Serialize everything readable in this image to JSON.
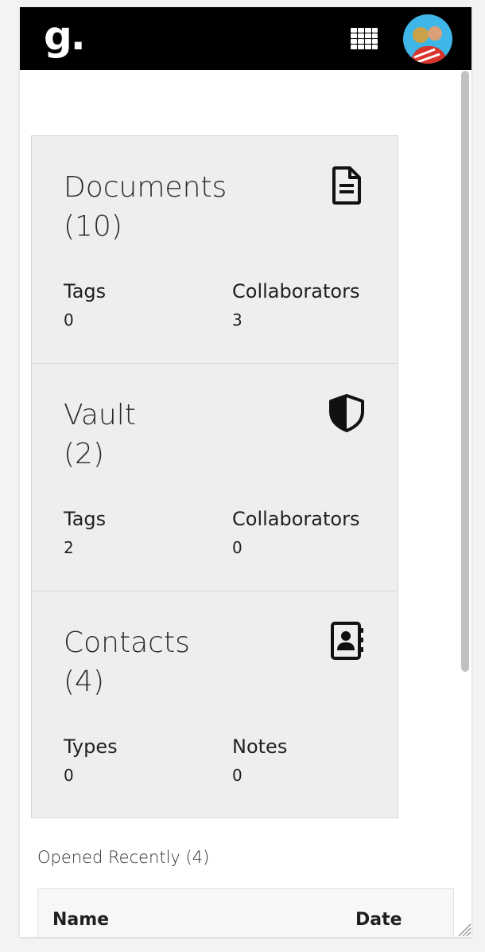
{
  "header": {
    "logo_text": "g.",
    "apps_icon": "grid-icon",
    "avatar_icon": "user-avatar"
  },
  "cards": [
    {
      "title": "Documents",
      "count": "(10)",
      "icon": "document-icon",
      "stats": [
        {
          "label": "Tags",
          "value": "0"
        },
        {
          "label": "Collaborators",
          "value": "3"
        }
      ]
    },
    {
      "title": "Vault",
      "count": "(2)",
      "icon": "shield-icon",
      "stats": [
        {
          "label": "Tags",
          "value": "2"
        },
        {
          "label": "Collaborators",
          "value": "0"
        }
      ]
    },
    {
      "title": "Contacts",
      "count": "(4)",
      "icon": "address-book-icon",
      "stats": [
        {
          "label": "Types",
          "value": "0"
        },
        {
          "label": "Notes",
          "value": "0"
        }
      ]
    }
  ],
  "recent": {
    "title": "Opened Recently (4)",
    "columns": [
      "Name",
      "Date"
    ]
  },
  "colors": {
    "topbar": "#000000",
    "card_bg": "#eeeeee",
    "text": "#2a2a2a"
  }
}
